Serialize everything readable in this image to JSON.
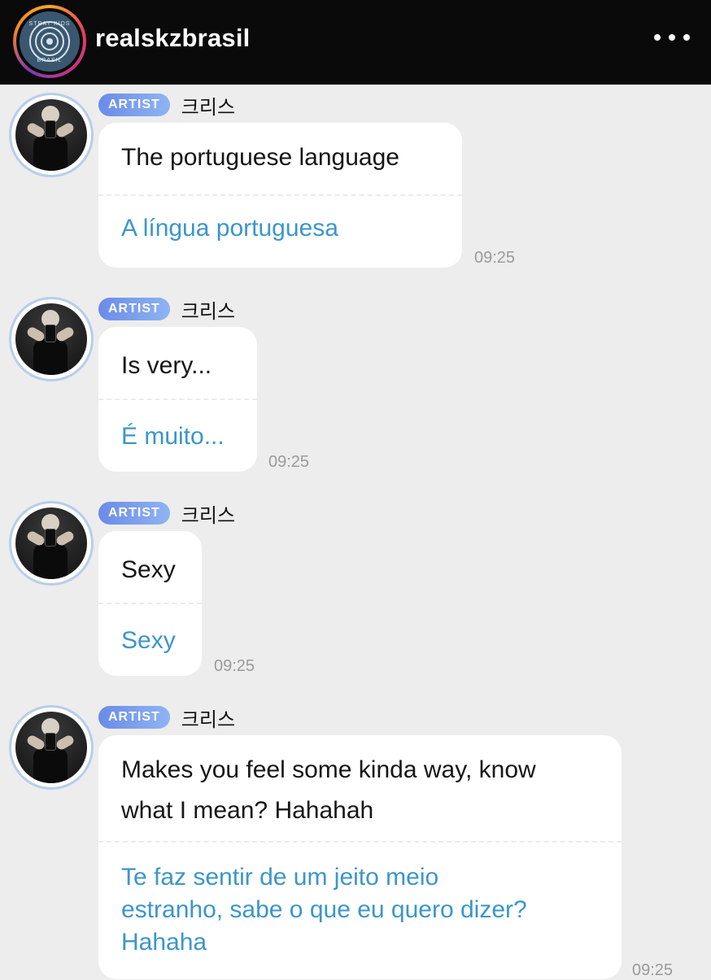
{
  "header": {
    "account_name": "realskzbrasil",
    "logo_text_top": "STRAY KIDS",
    "logo_text_bottom": "BRASIL"
  },
  "messages": [
    {
      "badge": "ARTIST",
      "sender": "크리스",
      "original": "The portuguese language",
      "translation": "A língua portuguesa",
      "time": "09:25"
    },
    {
      "badge": "ARTIST",
      "sender": "크리스",
      "original": "Is very...",
      "translation": "É muito...",
      "time": "09:25"
    },
    {
      "badge": "ARTIST",
      "sender": "크리스",
      "original": "Sexy",
      "translation": "Sexy",
      "time": "09:25"
    },
    {
      "badge": "ARTIST",
      "sender": "크리스",
      "original": "Makes you feel some kinda way, know\nwhat I mean? Hahahah",
      "translation": "Te faz sentir de um jeito meio\nestranho, sabe o que eu quero dizer?\nHahaha",
      "time": "09:25"
    }
  ],
  "colors": {
    "background": "#ededed",
    "topbar": "#0a0a0a",
    "bubble": "#ffffff",
    "translation_text": "#3b96c9",
    "badge_start": "#6a8be8",
    "badge_end": "#8fb4f2",
    "timestamp": "#9a9a9a"
  }
}
